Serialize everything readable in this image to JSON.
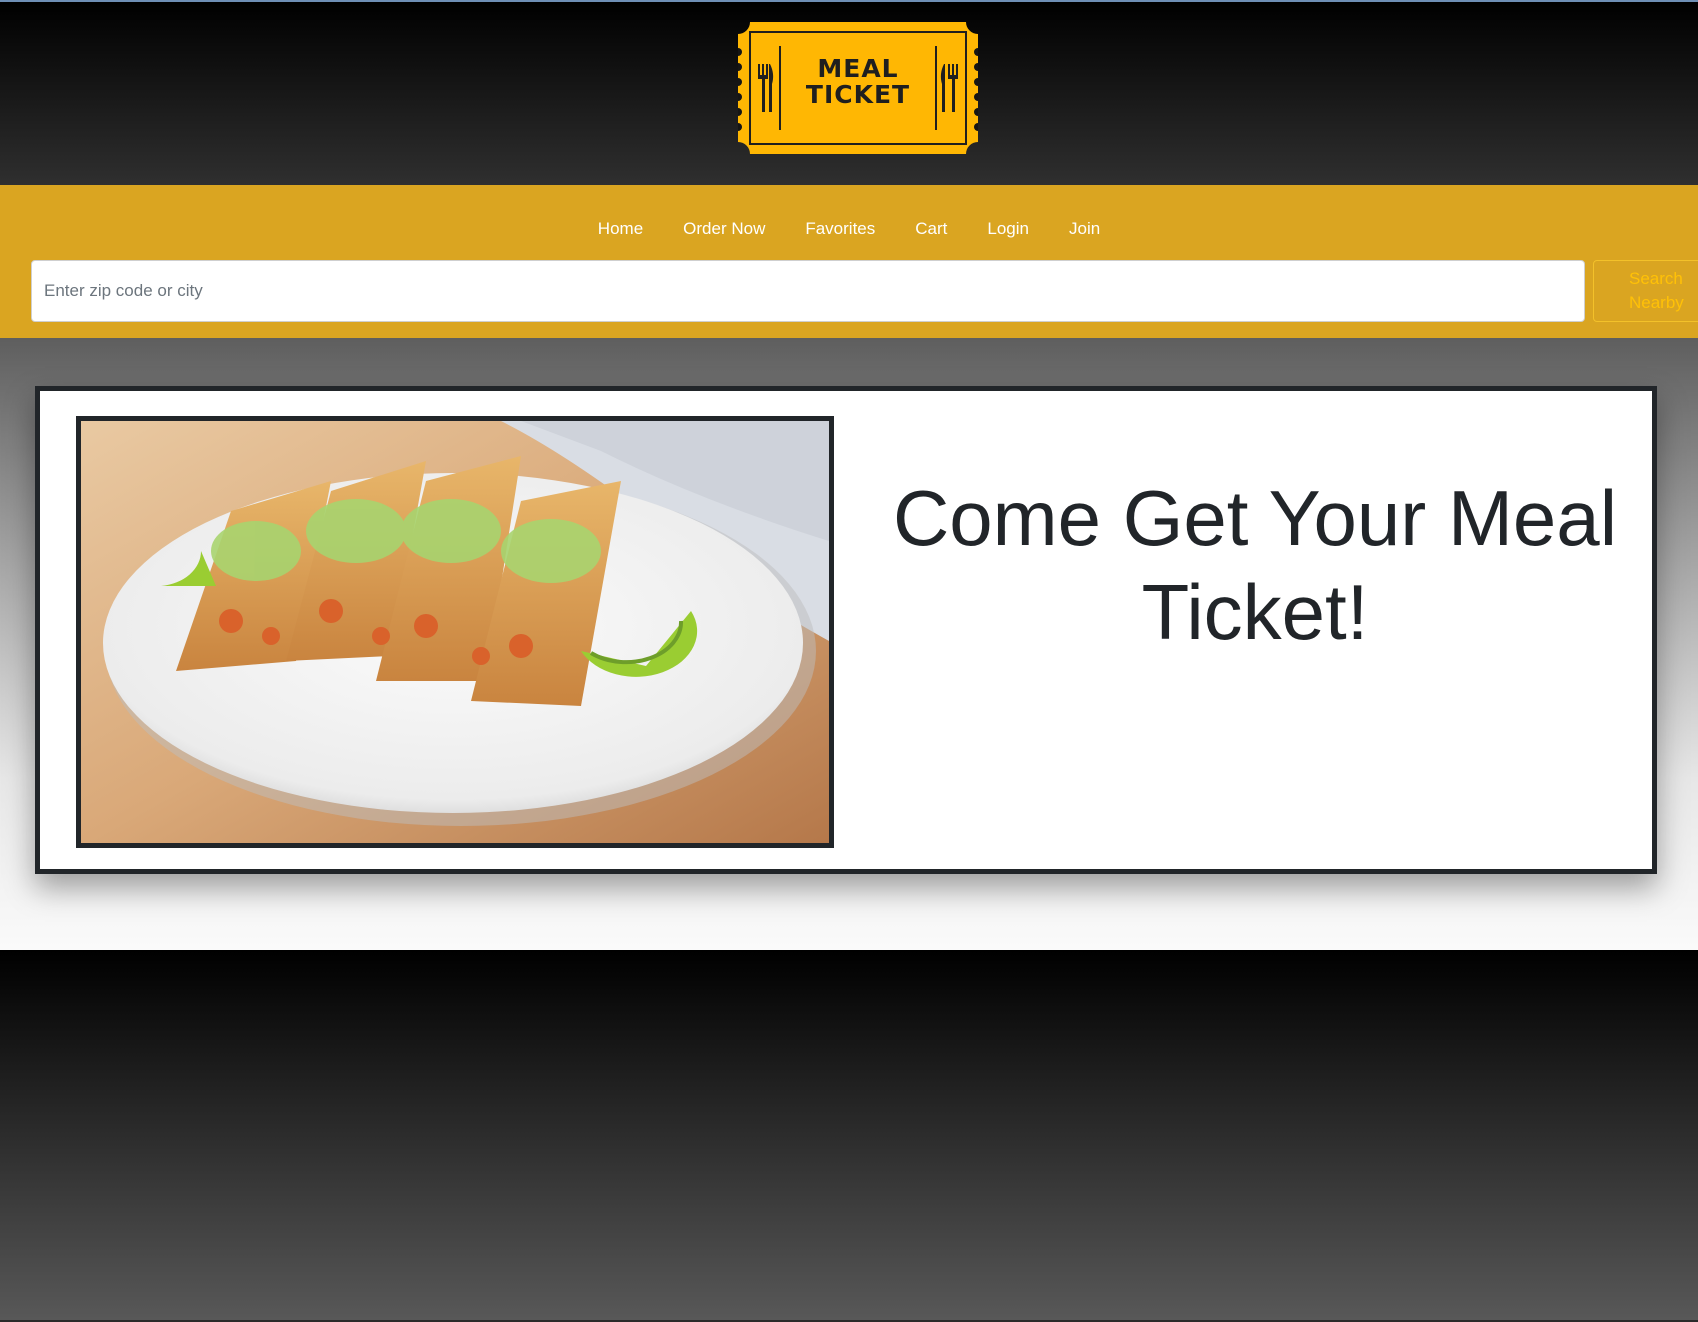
{
  "logo": {
    "line1": "MEAL",
    "line2": "TICKET",
    "color": "#ffb703",
    "icon": "fork-knife-icon"
  },
  "nav": {
    "items": [
      "Home",
      "Order Now",
      "Favorites",
      "Cart",
      "Login",
      "Join"
    ]
  },
  "search": {
    "placeholder": "Enter zip code or city",
    "value": "",
    "button_line1": "Search",
    "button_line2": "Nearby"
  },
  "hero": {
    "title": "Come Get Your Meal Ticket!",
    "image": "tacos-on-plate-image"
  },
  "colors": {
    "accent": "#daa521",
    "card_border": "#212529",
    "button_text": "#ffc107"
  }
}
